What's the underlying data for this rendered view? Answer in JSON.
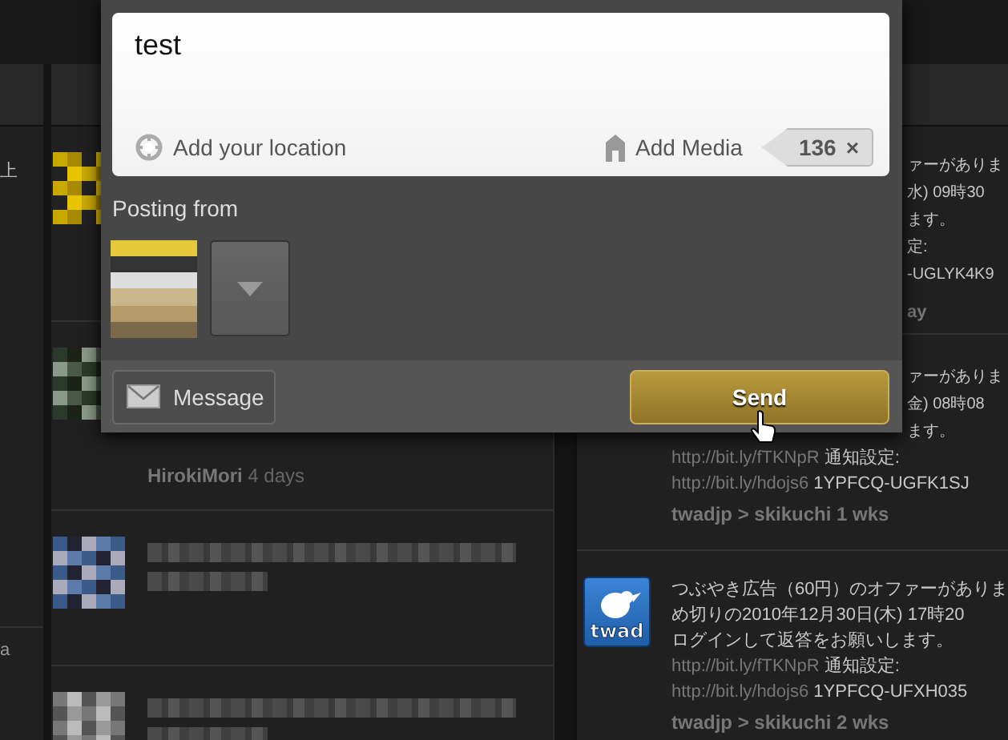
{
  "composer": {
    "text": "test",
    "location_label": "Add your location",
    "media_label": "Add Media",
    "char_count": "136",
    "clear_symbol": "×",
    "posting_from_label": "Posting from",
    "message_button": "Message",
    "send_button": "Send"
  },
  "left_column": {
    "texts": [
      "上",
      "a"
    ]
  },
  "middle_column": {
    "tweets": [
      {
        "kind": "blurred"
      },
      {
        "kind": "author",
        "author": "HirokiMori",
        "time": "4 days"
      },
      {
        "kind": "blurred"
      },
      {
        "kind": "blurred"
      }
    ]
  },
  "right_column": {
    "tweets": [
      {
        "covered": true,
        "lines": [
          "ァーがありま",
          "水) 09時30",
          "ます。",
          "定:",
          "-UGLYK4K9"
        ],
        "meta": "ay"
      },
      {
        "covered": true,
        "lines": [
          "ァーがありま",
          "金) 08時08",
          "ます。"
        ],
        "links": [
          {
            "url": "http://bit.ly/fTKNpR",
            "text": "通知設定:"
          },
          {
            "url": "http://bit.ly/hdojs6",
            "text": "1YPFCQ-UGFK1SJ"
          }
        ],
        "meta": "twadjp > skikuchi 1 wks"
      },
      {
        "covered": false,
        "logo_text": "twad",
        "lines": [
          "つぶやき広告（60円）のオファーがありま",
          "め切りの2010年12月30日(木) 17時20",
          "ログインして返答をお願いします。"
        ],
        "links": [
          {
            "url": "http://bit.ly/fTKNpR",
            "text": "通知設定:"
          },
          {
            "url": "http://bit.ly/hdojs6",
            "text": "1YPFCQ-UFXH035"
          }
        ],
        "meta": "twadjp > skikuchi 2 wks"
      }
    ]
  }
}
